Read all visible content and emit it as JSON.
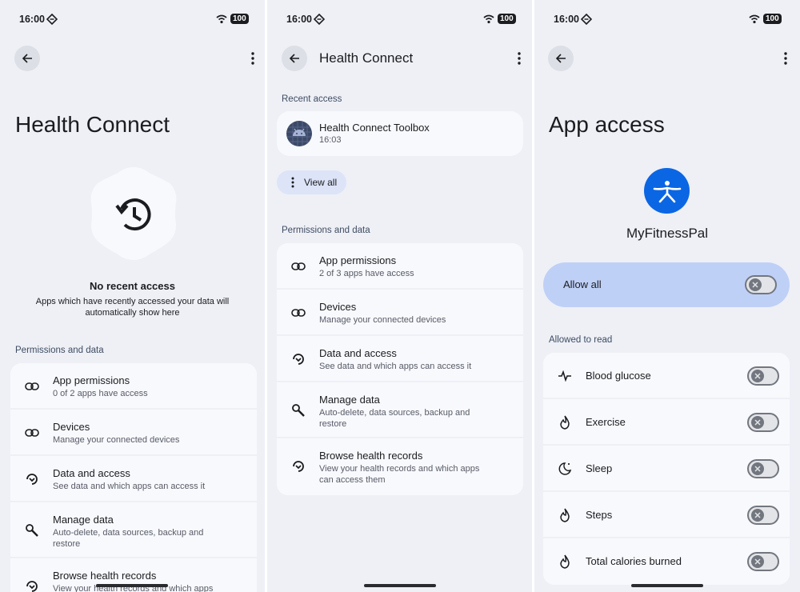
{
  "status": {
    "time": "16:00",
    "battery": "100"
  },
  "screen1": {
    "title": "Health Connect",
    "empty_title": "No recent access",
    "empty_desc_line1": "Apps which have recently accessed your data will",
    "empty_desc_line2": "automatically show here",
    "section_label": "Permissions and data",
    "items": [
      {
        "title": "App permissions",
        "sub": "0 of 2 apps have access"
      },
      {
        "title": "Devices",
        "sub": "Manage your connected devices"
      },
      {
        "title": "Data and access",
        "sub": "See data and which apps can access it"
      },
      {
        "title": "Manage data",
        "sub1": "Auto-delete, data sources, backup and",
        "sub2": "restore"
      },
      {
        "title": "Browse health records",
        "sub": "View your health records and which apps"
      }
    ]
  },
  "screen2": {
    "title": "Health Connect",
    "recent_label": "Recent access",
    "recent_app": {
      "name": "Health Connect Toolbox",
      "time": "16:03"
    },
    "view_all": "View all",
    "section_label": "Permissions and data",
    "items": [
      {
        "title": "App permissions",
        "sub": "2 of 3 apps have access"
      },
      {
        "title": "Devices",
        "sub": "Manage your connected devices"
      },
      {
        "title": "Data and access",
        "sub": "See data and which apps can access it"
      },
      {
        "title": "Manage data",
        "sub1": "Auto-delete, data sources, backup and",
        "sub2": "restore"
      },
      {
        "title": "Browse health records",
        "sub1": "View your health records and which apps",
        "sub2": "can access them"
      }
    ]
  },
  "screen3": {
    "title": "App access",
    "app_name": "MyFitnessPal",
    "allow_all": "Allow all",
    "section_label": "Allowed to read",
    "items": [
      {
        "label": "Blood glucose",
        "icon": "pulse-icon",
        "enabled": false
      },
      {
        "label": "Exercise",
        "icon": "flame-icon",
        "enabled": false
      },
      {
        "label": "Sleep",
        "icon": "moon-icon",
        "enabled": false
      },
      {
        "label": "Steps",
        "icon": "flame-icon",
        "enabled": false
      },
      {
        "label": "Total calories burned",
        "icon": "flame-icon",
        "enabled": false
      }
    ]
  },
  "colors": {
    "background": "#eef0f6",
    "card": "#f8f9fd",
    "accent": "#bfd0f7",
    "brand": "#0b66e4",
    "pill": "#dde4f8"
  }
}
